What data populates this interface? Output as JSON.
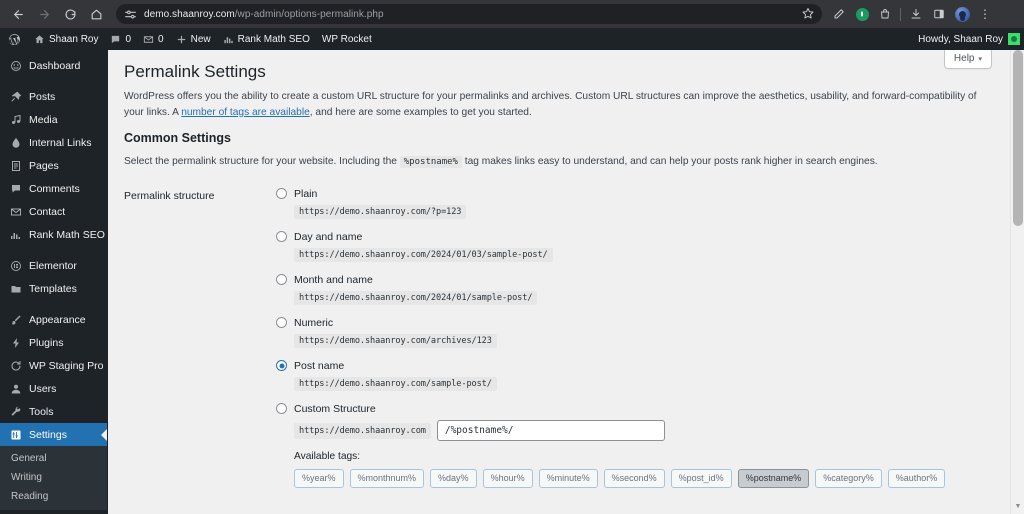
{
  "browser": {
    "back_icon": "back-arrow-icon",
    "forward_icon": "forward-arrow-icon",
    "reload_icon": "reload-icon",
    "home_icon": "home-icon",
    "site_settings_icon": "tune-sliders-icon",
    "url_host": "demo.shaanroy.com",
    "url_path": "/wp-admin/options-permalink.php",
    "star_icon": "bookmark-star-icon",
    "actions": [
      {
        "name": "edit-pencil-icon",
        "glyph": "✎"
      },
      {
        "name": "extension-green-indicator-icon",
        "glyph": ""
      },
      {
        "name": "shopping-bag-icon",
        "glyph": ""
      },
      {
        "name": "downloads-icon",
        "glyph": ""
      },
      {
        "name": "side-panel-icon",
        "glyph": ""
      },
      {
        "name": "profile-avatar-icon",
        "glyph": ""
      },
      {
        "name": "chrome-menu-icon",
        "glyph": "⋮"
      }
    ]
  },
  "adminbar": {
    "logo": "wordpress-logo-icon",
    "site_name": "Shaan Roy",
    "site_icon": "home-icon",
    "comments_count": "0",
    "comments_icon": "comment-bubble-icon",
    "mail_count": "0",
    "mail_icon": "envelope-icon",
    "new_label": "New",
    "new_icon": "plus-icon",
    "rank_math_label": "Rank Math SEO",
    "rank_math_icon": "bar-chart-icon",
    "wp_rocket_label": "WP Rocket",
    "howdy": "Howdy, Shaan Roy"
  },
  "sidebar": {
    "items": [
      {
        "label": "Dashboard",
        "icon": "dashboard-icon",
        "glyph": "⌘",
        "current": false,
        "gap_after": true
      },
      {
        "label": "Posts",
        "icon": "pin-icon",
        "glyph": "✒",
        "current": false
      },
      {
        "label": "Media",
        "icon": "media-icon",
        "glyph": "♫",
        "current": false
      },
      {
        "label": "Internal Links",
        "icon": "link-drop-icon",
        "glyph": "◆",
        "current": false
      },
      {
        "label": "Pages",
        "icon": "page-icon",
        "glyph": "▤",
        "current": false
      },
      {
        "label": "Comments",
        "icon": "comment-bubble-icon",
        "glyph": "■",
        "current": false
      },
      {
        "label": "Contact",
        "icon": "envelope-icon",
        "glyph": "✉",
        "current": false
      },
      {
        "label": "Rank Math SEO",
        "icon": "bar-chart-icon",
        "glyph": "▃",
        "current": false,
        "gap_after": true
      },
      {
        "label": "Elementor",
        "icon": "elementor-icon",
        "glyph": "Ⓔ",
        "current": false
      },
      {
        "label": "Templates",
        "icon": "folder-icon",
        "glyph": "▰",
        "current": false,
        "gap_after": true
      },
      {
        "label": "Appearance",
        "icon": "paintbrush-icon",
        "glyph": "✐",
        "current": false
      },
      {
        "label": "Plugins",
        "icon": "plug-icon",
        "glyph": "⚡",
        "current": false
      },
      {
        "label": "WP Staging Pro",
        "icon": "refresh-icon",
        "glyph": "↻",
        "current": false
      },
      {
        "label": "Users",
        "icon": "user-icon",
        "glyph": "♟",
        "current": false
      },
      {
        "label": "Tools",
        "icon": "wrench-icon",
        "glyph": "⚒",
        "current": false
      },
      {
        "label": "Settings",
        "icon": "settings-sliders-icon",
        "glyph": "⚙",
        "current": true
      }
    ],
    "submenu": [
      {
        "label": "General"
      },
      {
        "label": "Writing"
      },
      {
        "label": "Reading"
      }
    ]
  },
  "content": {
    "help_label": "Help",
    "help_caret": "▾",
    "page_title": "Permalink Settings",
    "intro_part1": "WordPress offers you the ability to create a custom URL structure for your permalinks and archives. Custom URL structures can improve the aesthetics, usability, and forward-compatibility of your links. A ",
    "intro_link": "number of tags are available",
    "intro_part2": ", and here are some examples to get you started.",
    "common_settings_heading": "Common Settings",
    "common_desc_part1": "Select the permalink structure for your website. Including the ",
    "common_desc_code": "%postname%",
    "common_desc_part2": " tag makes links easy to understand, and can help your posts rank higher in search engines.",
    "form_label": "Permalink structure",
    "options": [
      {
        "label": "Plain",
        "example": "https://demo.shaanroy.com/?p=123",
        "selected": false
      },
      {
        "label": "Day and name",
        "example": "https://demo.shaanroy.com/2024/01/03/sample-post/",
        "selected": false
      },
      {
        "label": "Month and name",
        "example": "https://demo.shaanroy.com/2024/01/sample-post/",
        "selected": false
      },
      {
        "label": "Numeric",
        "example": "https://demo.shaanroy.com/archives/123",
        "selected": false
      },
      {
        "label": "Post name",
        "example": "https://demo.shaanroy.com/sample-post/",
        "selected": true
      }
    ],
    "custom": {
      "label": "Custom Structure",
      "selected": false,
      "prefix": "https://demo.shaanroy.com",
      "value": "/%postname%/"
    },
    "available_tags_label": "Available tags:",
    "tags": [
      {
        "label": "%year%",
        "active": false
      },
      {
        "label": "%monthnum%",
        "active": false
      },
      {
        "label": "%day%",
        "active": false
      },
      {
        "label": "%hour%",
        "active": false
      },
      {
        "label": "%minute%",
        "active": false
      },
      {
        "label": "%second%",
        "active": false
      },
      {
        "label": "%post_id%",
        "active": false
      },
      {
        "label": "%postname%",
        "active": true
      },
      {
        "label": "%category%",
        "active": false
      },
      {
        "label": "%author%",
        "active": false
      }
    ]
  },
  "scrollbar": {
    "up_arrow": "▲",
    "down_arrow": "▼"
  },
  "colors": {
    "wp_blue": "#2271b1",
    "admin_dark": "#1d2327",
    "submenu_dark": "#2c3338",
    "chrome_dark": "#35363a"
  }
}
